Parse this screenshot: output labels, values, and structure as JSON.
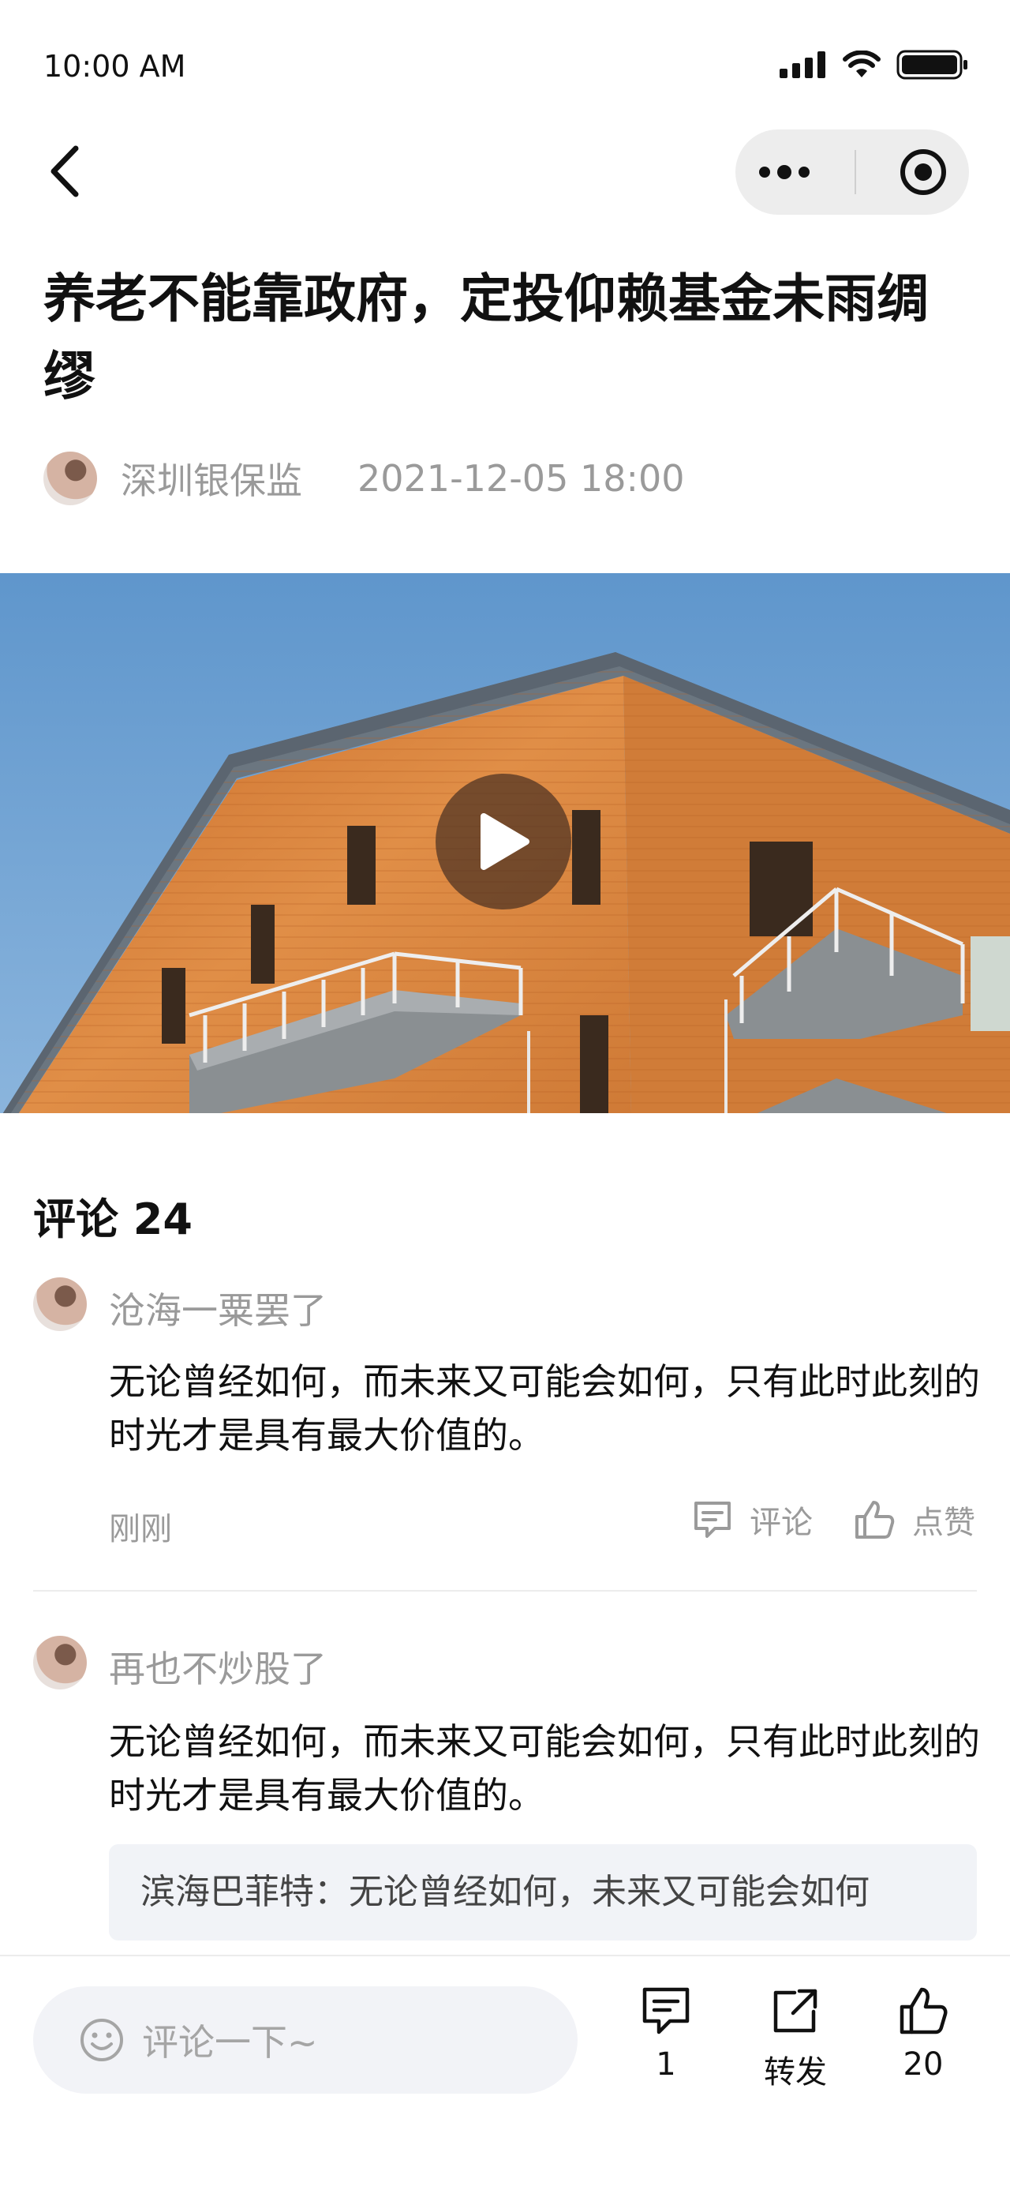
{
  "status_bar": {
    "time": "10:00 AM"
  },
  "article": {
    "title": "养老不能靠政府，定投仰赖基金未雨绸缪",
    "author": "深圳银保监",
    "publish_time": "2021-12-05 18:00"
  },
  "comments": {
    "heading": "评论 24",
    "items": [
      {
        "user": "沧海一粟罢了",
        "text": "无论曾经如何，而未来又可能会如何，只有此时此刻的时光才是具有最大价值的。",
        "time": "刚刚",
        "reply_label": "评论",
        "like_label": "点赞"
      },
      {
        "user": "再也不炒股了",
        "text": "无论曾经如何，而未来又可能会如何，只有此时此刻的时光才是具有最大价值的。",
        "reply_preview": "滨海巴菲特：无论曾经如何，未来又可能会如何"
      }
    ]
  },
  "bottom_bar": {
    "input_placeholder": "评论一下~",
    "comment_count": "1",
    "share_label": "转发",
    "like_count": "20"
  },
  "colors": {
    "muted_text": "#9a9a9a",
    "input_bg": "#f2f3f7",
    "sky": "#6e9fcf",
    "wood": "#d9823c"
  }
}
